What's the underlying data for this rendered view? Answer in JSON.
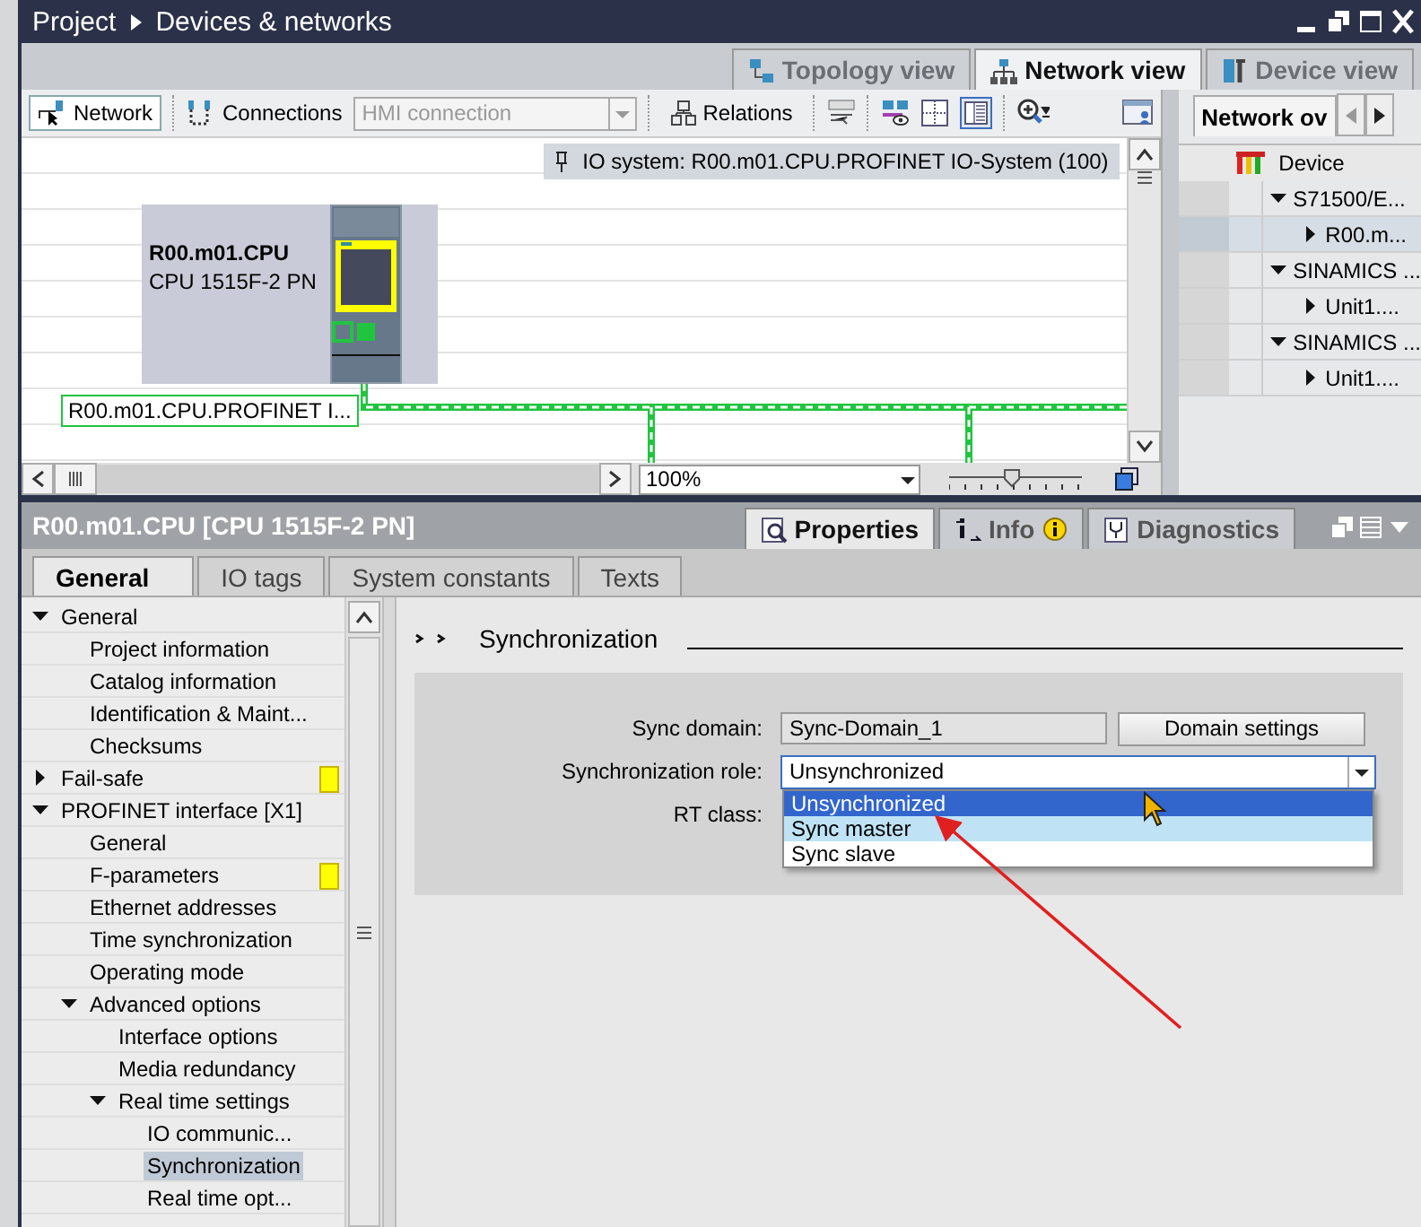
{
  "breadcrumb": [
    "Project",
    "Devices & networks"
  ],
  "view_tabs": [
    {
      "label": "Topology view",
      "selected": false,
      "kind": "topology"
    },
    {
      "label": "Network view",
      "selected": true,
      "kind": "network"
    },
    {
      "label": "Device view",
      "selected": false,
      "kind": "device"
    }
  ],
  "toolbar": {
    "network_button": {
      "label": "Network",
      "pressed": true
    },
    "connections_label": "Connections",
    "connection_type": {
      "value": "HMI connection",
      "disabled": true
    },
    "relations_label": "Relations"
  },
  "canvas": {
    "io_system": "IO system: R00.m01.CPU.PROFINET IO-System (100)",
    "device": {
      "name": "R00.m01.CPU",
      "type": "CPU 1515F-2 PN"
    },
    "subnet_label": "R00.m01.CPU.PROFINET I...",
    "zoom": "100%",
    "zoom_slider": {
      "level": 0.47
    }
  },
  "network_overview": {
    "tab": "Network ov",
    "column": "Device",
    "rows": [
      {
        "label": "S71500/E...",
        "expanded": true,
        "selected": false,
        "children": [
          {
            "label": "R00.m...",
            "expanded": false,
            "selected": true
          }
        ]
      },
      {
        "label": "SINAMICS ...",
        "expanded": true,
        "selected": false,
        "children": [
          {
            "label": "Unit1....",
            "expanded": false,
            "selected": false
          }
        ]
      },
      {
        "label": "SINAMICS ...",
        "expanded": true,
        "selected": false,
        "children": [
          {
            "label": "Unit1....",
            "expanded": false,
            "selected": false
          }
        ]
      }
    ]
  },
  "properties": {
    "title": "R00.m01.CPU [CPU 1515F-2 PN]",
    "tabs": [
      {
        "label": "Properties",
        "selected": true,
        "kind": "properties"
      },
      {
        "label": "Info",
        "selected": false,
        "kind": "info"
      },
      {
        "label": "Diagnostics",
        "selected": false,
        "kind": "diagnostics"
      }
    ],
    "subtabs": [
      {
        "label": "General",
        "selected": true
      },
      {
        "label": "IO tags",
        "selected": false
      },
      {
        "label": "System constants",
        "selected": false
      },
      {
        "label": "Texts",
        "selected": false
      }
    ]
  },
  "nav_tree": [
    {
      "label": "General",
      "expanded": true,
      "selected": false,
      "warning": false,
      "children": [
        {
          "label": "Project information",
          "selected": false,
          "warning": false
        },
        {
          "label": "Catalog information",
          "selected": false,
          "warning": false
        },
        {
          "label": "Identification & Maint...",
          "selected": false,
          "warning": false
        },
        {
          "label": "Checksums",
          "selected": false,
          "warning": false
        }
      ]
    },
    {
      "label": "Fail-safe",
      "expanded": false,
      "selected": false,
      "warning": true
    },
    {
      "label": "PROFINET interface [X1]",
      "expanded": true,
      "selected": false,
      "warning": false,
      "children": [
        {
          "label": "General",
          "selected": false,
          "warning": false
        },
        {
          "label": "F-parameters",
          "selected": false,
          "warning": true
        },
        {
          "label": "Ethernet addresses",
          "selected": false,
          "warning": false
        },
        {
          "label": "Time synchronization",
          "selected": false,
          "warning": false
        },
        {
          "label": "Operating mode",
          "selected": false,
          "warning": false
        },
        {
          "label": "Advanced options",
          "expanded": true,
          "selected": false,
          "warning": false,
          "children": [
            {
              "label": "Interface options",
              "selected": false,
              "warning": false
            },
            {
              "label": "Media redundancy",
              "selected": false,
              "warning": false
            },
            {
              "label": "Real time settings",
              "expanded": true,
              "selected": false,
              "warning": false,
              "children": [
                {
                  "label": "IO communic...",
                  "selected": false,
                  "warning": false
                },
                {
                  "label": "Synchronization",
                  "selected": true,
                  "warning": false
                },
                {
                  "label": "Real time opt...",
                  "selected": false,
                  "warning": false
                }
              ]
            }
          ]
        }
      ]
    }
  ],
  "section": {
    "title": "Synchronization"
  },
  "sync_domain": {
    "label": "Sync domain:",
    "value": "Sync-Domain_1",
    "button": "Domain settings"
  },
  "sync_role": {
    "label": "Synchronization role:",
    "value": "Unsynchronized",
    "expanded": true,
    "options": [
      {
        "label": "Unsynchronized",
        "selected": true,
        "hovered": false
      },
      {
        "label": "Sync master",
        "selected": false,
        "hovered": true
      },
      {
        "label": "Sync slave",
        "selected": false,
        "hovered": false
      }
    ]
  },
  "rt_class": {
    "label": "RT class:"
  }
}
